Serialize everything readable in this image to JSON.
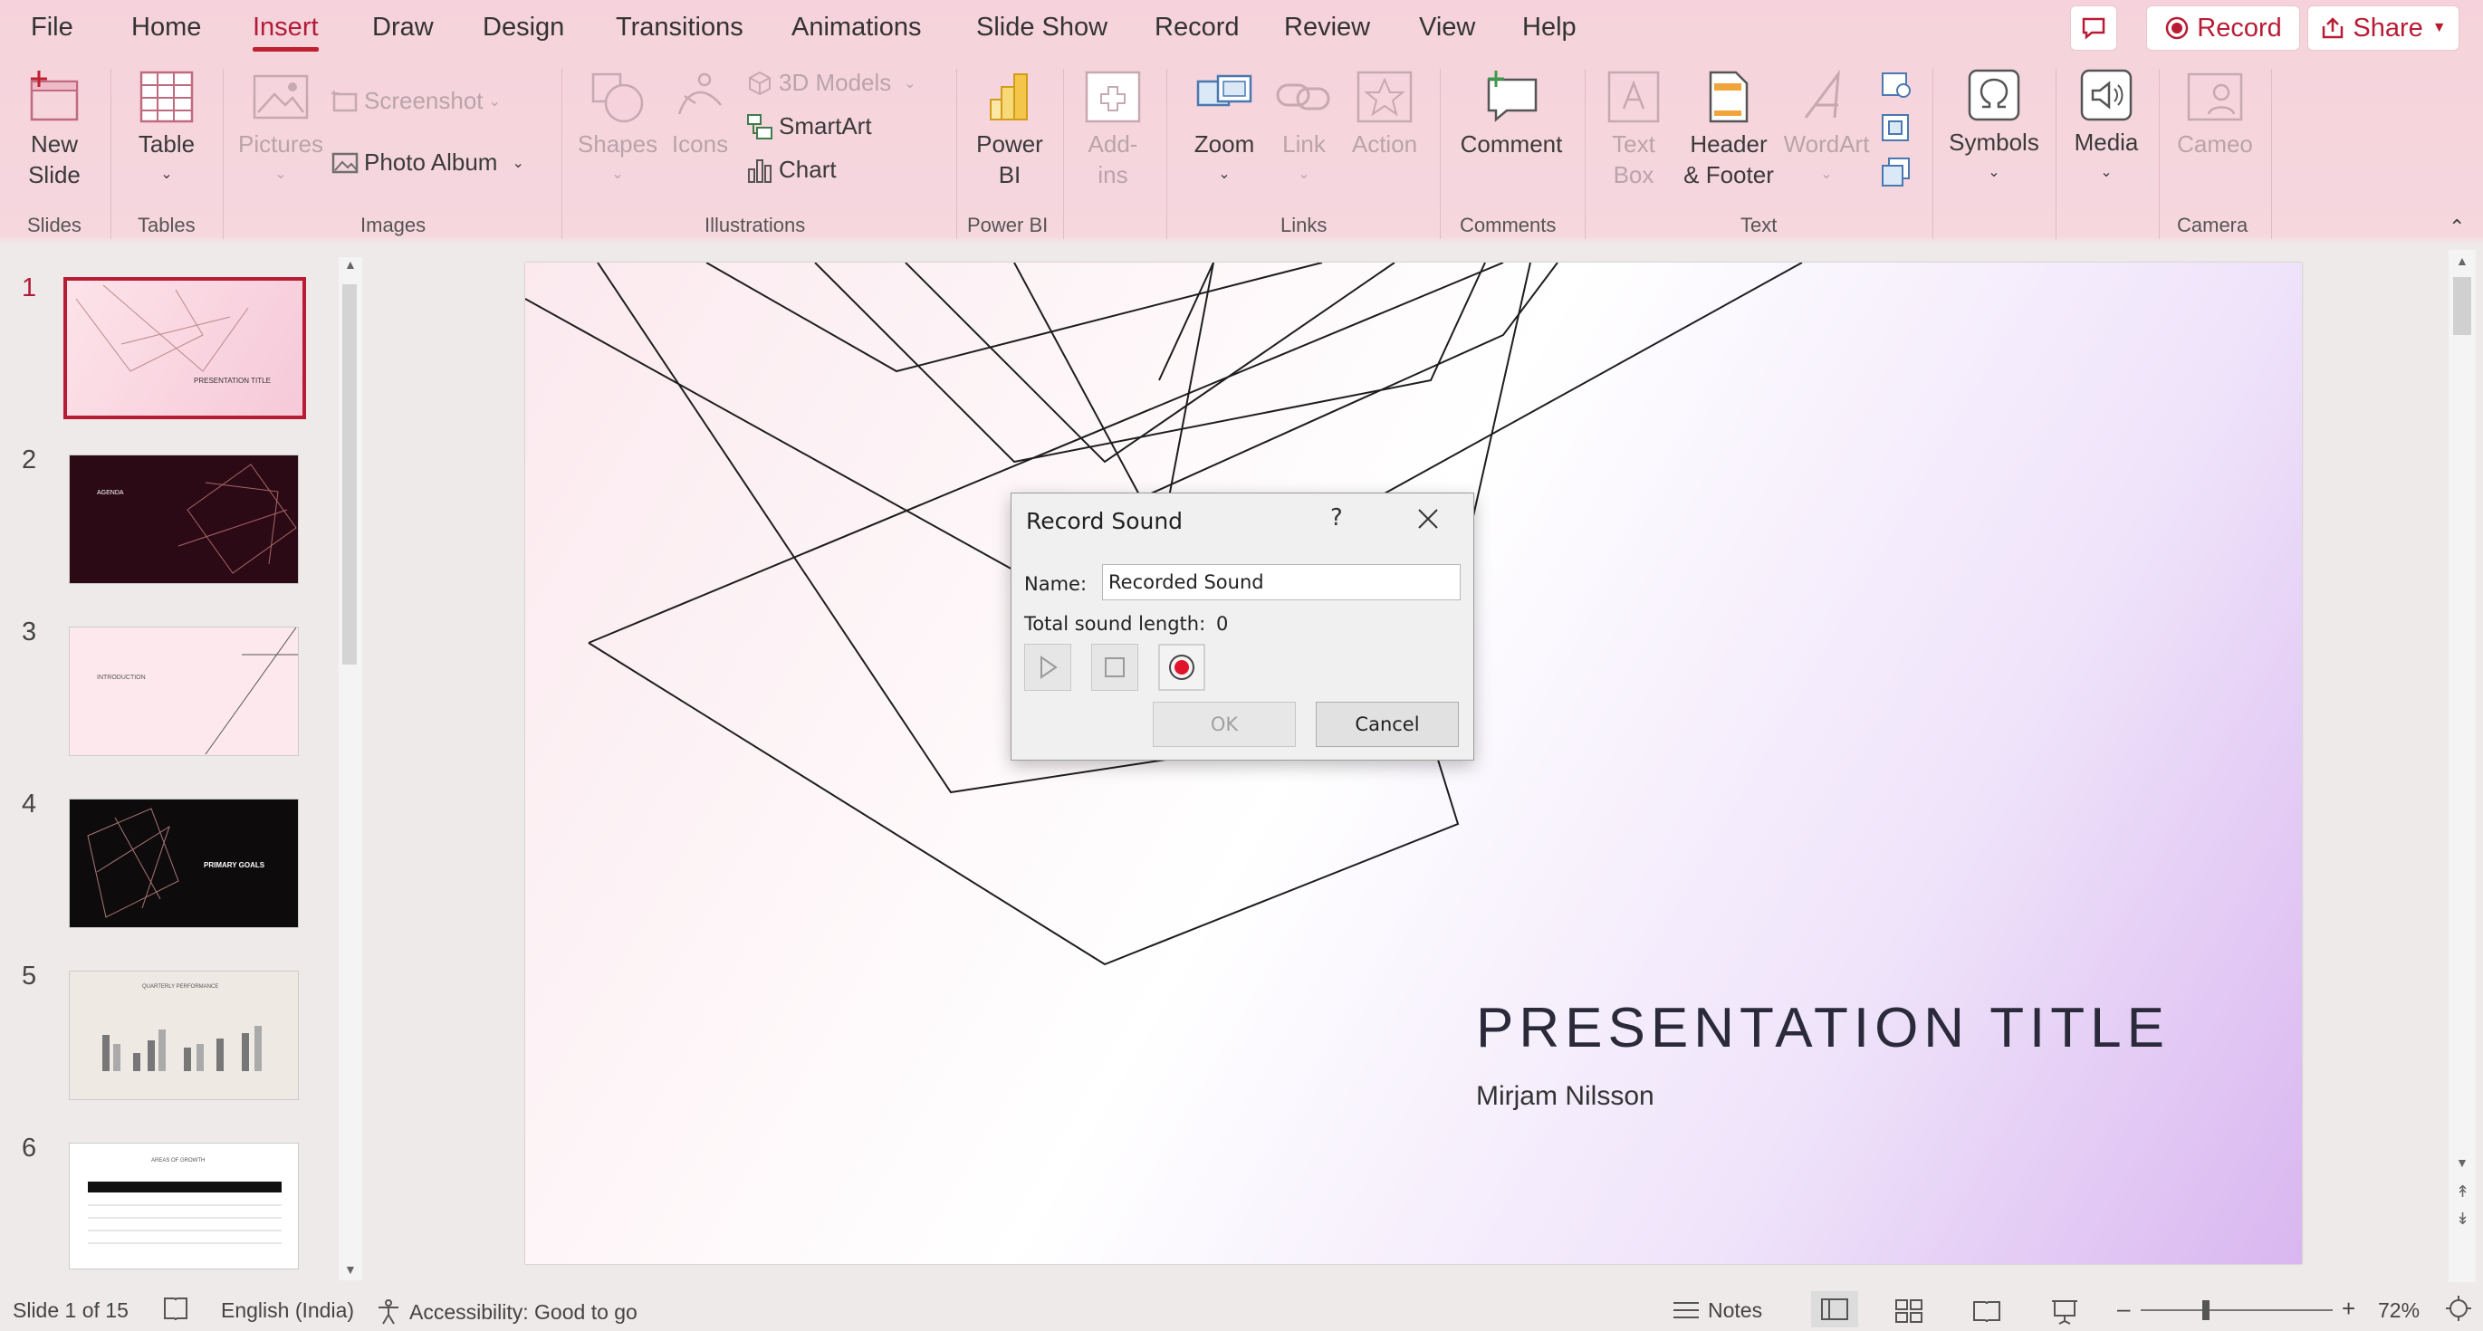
{
  "menu": {
    "tabs": [
      "File",
      "Home",
      "Insert",
      "Draw",
      "Design",
      "Transitions",
      "Animations",
      "Slide Show",
      "Record",
      "Review",
      "View",
      "Help"
    ],
    "active": "Insert",
    "record_label": "Record",
    "share_label": "Share"
  },
  "ribbon": {
    "new_slide": "New\nSlide",
    "table": "Table",
    "pictures": "Pictures",
    "screenshot": "Screenshot",
    "photo_album": "Photo Album",
    "shapes": "Shapes",
    "icons": "Icons",
    "models_3d": "3D Models",
    "smartart": "SmartArt",
    "chart": "Chart",
    "power_bi": "Power\nBI",
    "add_ins": "Add-\nins",
    "zoom": "Zoom",
    "link": "Link",
    "action": "Action",
    "comment": "Comment",
    "text_box": "Text\nBox",
    "header_footer": "Header\n& Footer",
    "wordart": "WordArt",
    "symbols": "Symbols",
    "media": "Media",
    "cameo": "Cameo",
    "groups": {
      "slides": "Slides",
      "tables": "Tables",
      "images": "Images",
      "illustrations": "Illustrations",
      "power_bi": "Power BI",
      "links": "Links",
      "comments": "Comments",
      "text": "Text",
      "camera": "Camera"
    }
  },
  "thumbnails": {
    "numbers": [
      "1",
      "2",
      "3",
      "4",
      "5",
      "6"
    ],
    "slide1_title": "PRESENTATION TITLE",
    "slide2_title": "AGENDA",
    "slide3_title": "INTRODUCTION",
    "slide4_title": "PRIMARY GOALS",
    "slide5_title": "QUARTERLY PERFORMANCE",
    "slide6_title": "AREAS OF GROWTH"
  },
  "slide": {
    "title": "PRESENTATION TITLE",
    "subtitle": "Mirjam Nilsson"
  },
  "dialog": {
    "title": "Record Sound",
    "help": "?",
    "name_label": "Name:",
    "name_value": "Recorded Sound",
    "length_label": "Total sound length:",
    "length_value": "0",
    "ok_label": "OK",
    "cancel_label": "Cancel"
  },
  "status": {
    "slide_count": "Slide 1 of 15",
    "language": "English (India)",
    "accessibility": "Accessibility: Good to go",
    "notes": "Notes",
    "zoom": "72%"
  },
  "colors": {
    "accent": "#b81c35",
    "ribbon_bg": "#f6d3dc",
    "dialog_bg": "#f0f0f0"
  }
}
